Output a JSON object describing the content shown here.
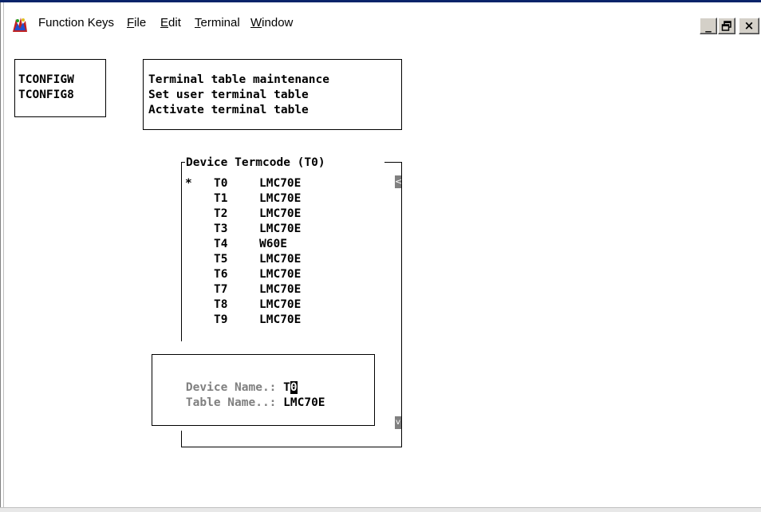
{
  "menubar": {
    "app_icon": "app-logo-icon",
    "items": [
      {
        "label": "Function Keys"
      },
      {
        "pre": "",
        "u": "F",
        "post": "ile"
      },
      {
        "pre": "",
        "u": "E",
        "post": "dit"
      },
      {
        "pre": "",
        "u": "T",
        "post": "erminal"
      },
      {
        "pre": "",
        "u": "W",
        "post": "indow"
      }
    ],
    "window_buttons": {
      "minimize": "_",
      "restore": "🗗",
      "close": "×"
    }
  },
  "programs": [
    "TCONFIGW",
    "TCONFIG8"
  ],
  "descriptions": [
    "Terminal table maintenance",
    "Set user terminal table",
    "Activate terminal table"
  ],
  "device_list": {
    "title": "Device Termcode (T0)",
    "rows": [
      {
        "mark": "*",
        "device": "T0",
        "termcode": "LMC70E"
      },
      {
        "mark": "",
        "device": "T1",
        "termcode": "LMC70E"
      },
      {
        "mark": "",
        "device": "T2",
        "termcode": "LMC70E"
      },
      {
        "mark": "",
        "device": "T3",
        "termcode": "LMC70E"
      },
      {
        "mark": "",
        "device": "T4",
        "termcode": "W60E"
      },
      {
        "mark": "",
        "device": "T5",
        "termcode": "LMC70E"
      },
      {
        "mark": "",
        "device": "T6",
        "termcode": "LMC70E"
      },
      {
        "mark": "",
        "device": "T7",
        "termcode": "LMC70E"
      },
      {
        "mark": "",
        "device": "T8",
        "termcode": "LMC70E"
      },
      {
        "mark": "",
        "device": "T9",
        "termcode": "LMC70E"
      }
    ],
    "scroll_up": "<",
    "scroll_down": "v"
  },
  "detail": {
    "device_label": "Device Name.:",
    "device_value_prefix": "T",
    "device_value_cursor": "0",
    "table_label": "Table Name..:",
    "table_value": "LMC70E"
  }
}
